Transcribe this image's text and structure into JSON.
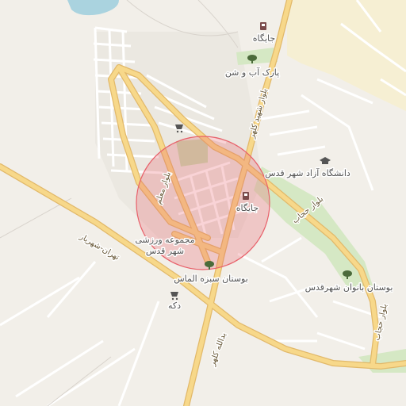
{
  "map": {
    "labels": {
      "gas1": "جایگاه",
      "gas2": "جایگاه",
      "park_water": "پارک آب و شن",
      "azad_univ": "دانشگاه آزاد شهر قدس",
      "sports_line1": "مجموعه ورزشی",
      "sports_line2": "شهر قدس",
      "almas_park": "بوستان سبزه الماس",
      "banovan_park": "بوستان بانوان شهرقدس",
      "shop": "دکه"
    },
    "roads": {
      "tehran_shahriar": "تهران-شهریار",
      "blvd_moallem": "بلوار معلم",
      "blvd_shahid_kalhor": "بلوار شهید کلهر",
      "blvd_hejab": "بلوار حجاب",
      "blvd_hejab_2": "بلوار حجاب",
      "abdollah_kalhor": "بدالله کلهر"
    },
    "icons": [
      "fuel-icon",
      "tree-icon",
      "graduation-cap-icon",
      "shopping-cart-icon"
    ],
    "colors": {
      "background": "#f2efe9",
      "major_road": "#f7d88a",
      "minor_road": "#ffffff",
      "park": "#d5e8c4",
      "water": "#aad3df",
      "residential_yellow": "#f6efd3",
      "highlight_circle": "#e8606a"
    }
  }
}
